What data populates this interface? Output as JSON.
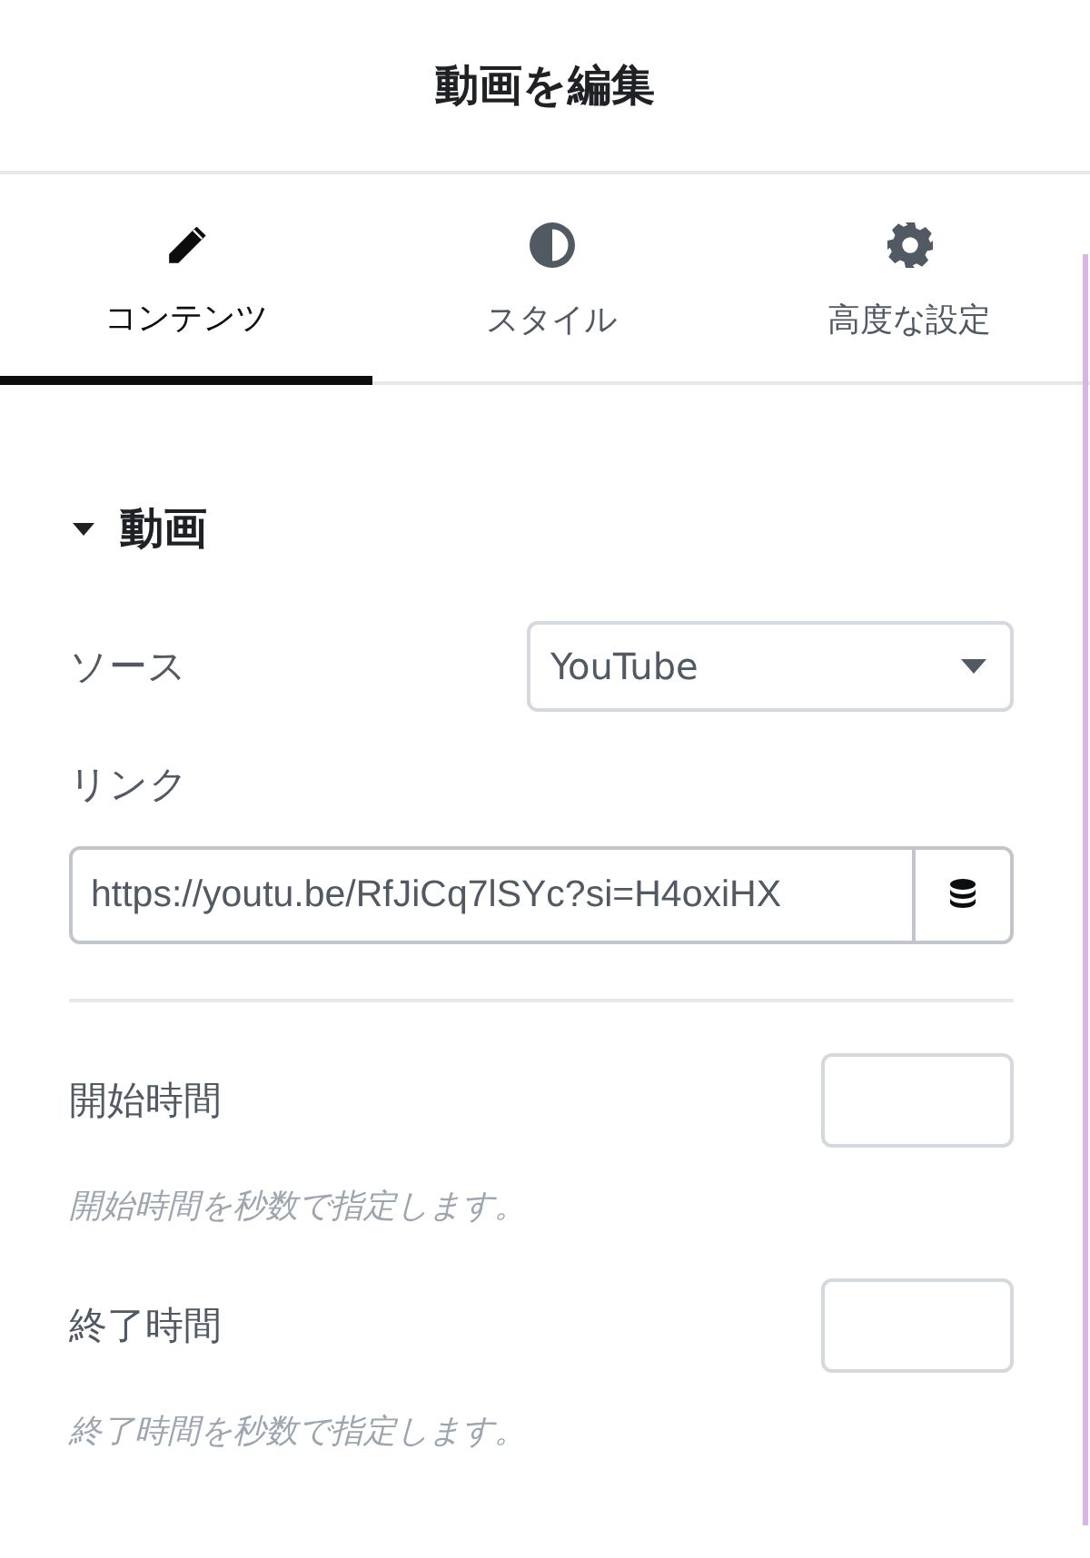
{
  "header": {
    "title": "動画を編集"
  },
  "tabs": [
    {
      "label": "コンテンツ",
      "kind": "pencil",
      "selected": true
    },
    {
      "label": "スタイル",
      "kind": "contrast",
      "selected": false
    },
    {
      "label": "高度な設定",
      "kind": "gear",
      "selected": false
    }
  ],
  "section": {
    "title": "動画",
    "expanded": true
  },
  "source": {
    "label": "ソース",
    "value": "YouTube"
  },
  "link": {
    "label": "リンク",
    "value": "https://youtu.be/RfJiCq7lSYc?si=H4oxiHX"
  },
  "fields": [
    {
      "label": "開始時間",
      "hint": "開始時間を秒数で指定します。"
    },
    {
      "label": "終了時間",
      "hint": "終了時間を秒数で指定します。"
    }
  ]
}
